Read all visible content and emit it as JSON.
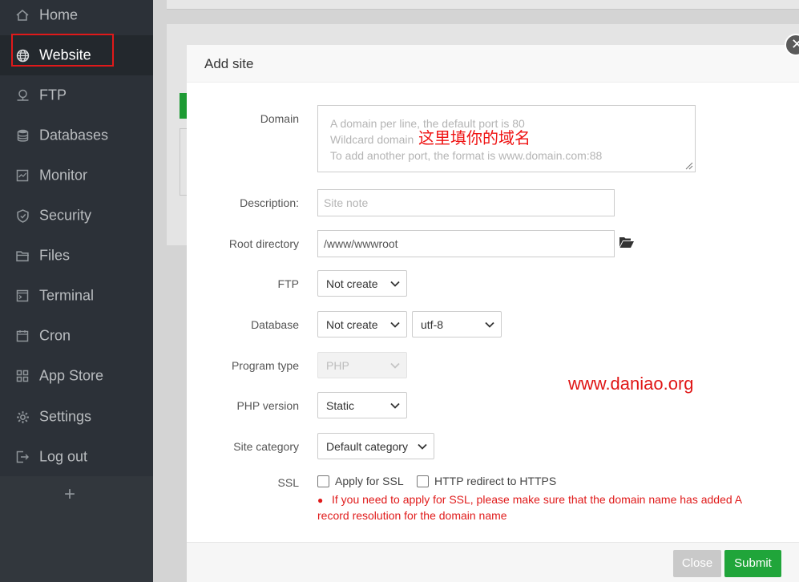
{
  "sidebar": {
    "items": [
      {
        "label": "Home",
        "icon": "home-icon"
      },
      {
        "label": "Website",
        "icon": "globe-icon"
      },
      {
        "label": "FTP",
        "icon": "ftp-icon"
      },
      {
        "label": "Databases",
        "icon": "database-icon"
      },
      {
        "label": "Monitor",
        "icon": "monitor-icon"
      },
      {
        "label": "Security",
        "icon": "shield-icon"
      },
      {
        "label": "Files",
        "icon": "folder-icon"
      },
      {
        "label": "Terminal",
        "icon": "terminal-icon"
      },
      {
        "label": "Cron",
        "icon": "calendar-icon"
      },
      {
        "label": "App Store",
        "icon": "grid-icon"
      },
      {
        "label": "Settings",
        "icon": "gear-icon"
      },
      {
        "label": "Log out",
        "icon": "logout-icon"
      }
    ],
    "active_index": 1,
    "add_label": "+"
  },
  "modal": {
    "title": "Add site",
    "domain": {
      "label": "Domain",
      "placeholder_lines": [
        "A domain per line, the default port is 80",
        "Wildcard domain",
        "To add another port, the format is www.domain.com:88"
      ]
    },
    "description": {
      "label": "Description:",
      "placeholder": "Site note"
    },
    "root_directory": {
      "label": "Root directory",
      "value": "/www/wwwroot"
    },
    "ftp": {
      "label": "FTP",
      "selected": "Not create"
    },
    "database": {
      "label": "Database",
      "selected": "Not create",
      "charset": "utf-8"
    },
    "program_type": {
      "label": "Program type",
      "selected": "PHP"
    },
    "php_version": {
      "label": "PHP version",
      "selected": "Static"
    },
    "site_category": {
      "label": "Site category",
      "selected": "Default category"
    },
    "ssl": {
      "label": "SSL",
      "apply_label": "Apply for SSL",
      "redirect_label": "HTTP redirect to HTTPS",
      "note": "If you need to apply for SSL, please make sure that the domain name has added A record resolution for the domain name"
    },
    "buttons": {
      "close": "Close",
      "submit": "Submit"
    }
  },
  "annotations": {
    "domain_hint_cn": "这里填你的域名",
    "watermark": "www.daniao.org"
  },
  "colors": {
    "sidebar_bg": "#2c3138",
    "accent_green": "#20a53a",
    "annotation_red": "#e01616"
  }
}
